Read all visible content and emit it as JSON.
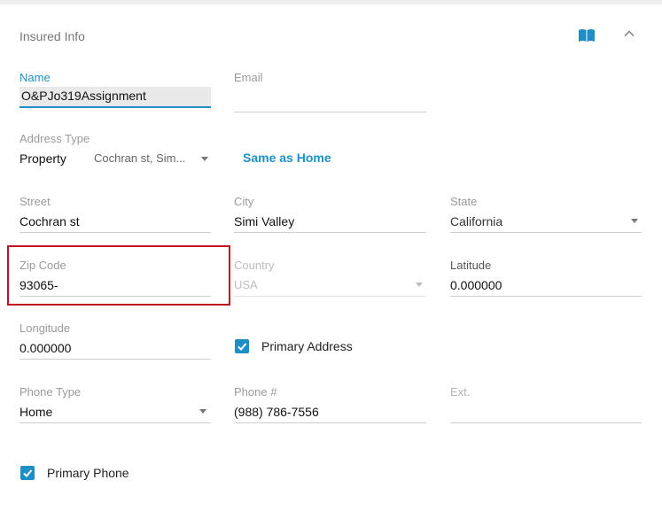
{
  "section": {
    "title": "Insured Info",
    "icons": [
      "book-icon",
      "chevron-up-icon"
    ]
  },
  "name": {
    "label": "Name",
    "value": "O&PJo319Assignment"
  },
  "email": {
    "label": "Email",
    "value": ""
  },
  "address_type": {
    "label": "Address Type",
    "value": "Property",
    "summary": "Cochran st, Sim...",
    "same_as_home": "Same as Home"
  },
  "street": {
    "label": "Street",
    "value": "Cochran st"
  },
  "city": {
    "label": "City",
    "value": "Simi Valley"
  },
  "state": {
    "label": "State",
    "value": "California"
  },
  "zip": {
    "label": "Zip Code",
    "value": "93065-"
  },
  "country": {
    "label": "Country",
    "value": "USA"
  },
  "latitude": {
    "label": "Latitude",
    "value": "0.000000"
  },
  "longitude": {
    "label": "Longitude",
    "value": "0.000000"
  },
  "primary_address": {
    "label": "Primary Address",
    "checked": true
  },
  "phone_type": {
    "label": "Phone Type",
    "value": "Home"
  },
  "phone": {
    "label": "Phone #",
    "value": "(988) 786-7556"
  },
  "ext": {
    "label": "Ext.",
    "value": ""
  },
  "primary_phone": {
    "label": "Primary Phone",
    "checked": true
  },
  "colors": {
    "accent": "#1e8fc6",
    "highlight": "#c0121a"
  }
}
